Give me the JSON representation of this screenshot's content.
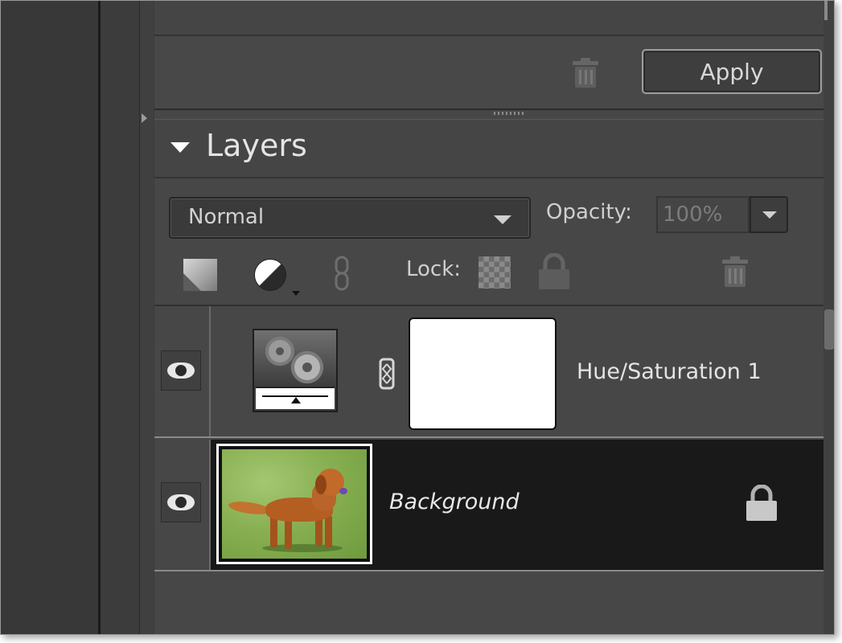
{
  "apply_bar": {
    "apply_label": "Apply"
  },
  "layers_panel": {
    "title": "Layers",
    "blend_mode": "Normal",
    "opacity_label": "Opacity:",
    "opacity_value": "100%",
    "lock_label": "Lock:"
  },
  "layers": [
    {
      "name": "Hue/Saturation 1",
      "type": "adjustment",
      "visible": true
    },
    {
      "name": "Background",
      "type": "image",
      "visible": true,
      "locked": true,
      "selected": true
    }
  ],
  "colors": {
    "panel_bg": "#474747",
    "selected_row_bg": "#191919",
    "text": "#e4e4e4"
  },
  "icons": [
    "trash-icon",
    "new-layer-icon",
    "adjustment-layer-icon",
    "link-icon",
    "lock-transparent-pixels-icon",
    "lock-all-icon",
    "eye-icon",
    "chain-icon",
    "lock-icon"
  ]
}
